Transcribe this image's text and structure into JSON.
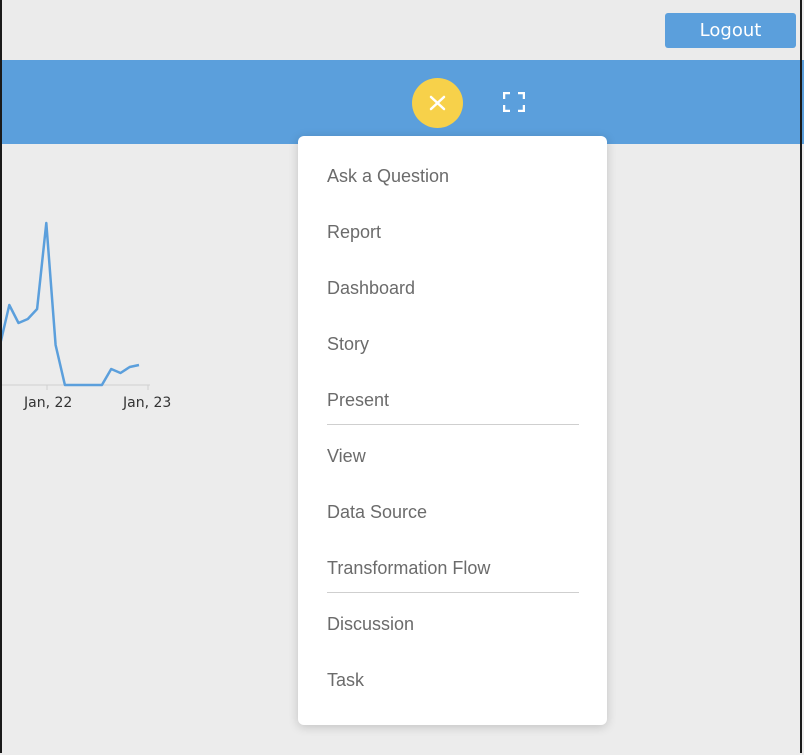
{
  "header": {
    "logout_label": "Logout"
  },
  "toolbar": {
    "close_icon": "close-icon",
    "expand_icon": "fullscreen-icon",
    "accent_color": "#5b9fdc",
    "close_color": "#f7d14a"
  },
  "chart_data": {
    "type": "line",
    "tick_labels": [
      "Jan, 22",
      "Jan, 23"
    ],
    "series": [
      {
        "values": [
          40,
          80,
          62,
          66,
          76,
          162,
          40,
          0,
          0,
          0,
          0,
          0,
          16,
          12,
          18,
          20
        ]
      }
    ],
    "color": "#5b9fdc"
  },
  "menu": {
    "groups": [
      [
        "Ask a Question",
        "Report",
        "Dashboard",
        "Story",
        "Present"
      ],
      [
        "View",
        "Data Source",
        "Transformation Flow"
      ],
      [
        "Discussion",
        "Task"
      ]
    ]
  }
}
